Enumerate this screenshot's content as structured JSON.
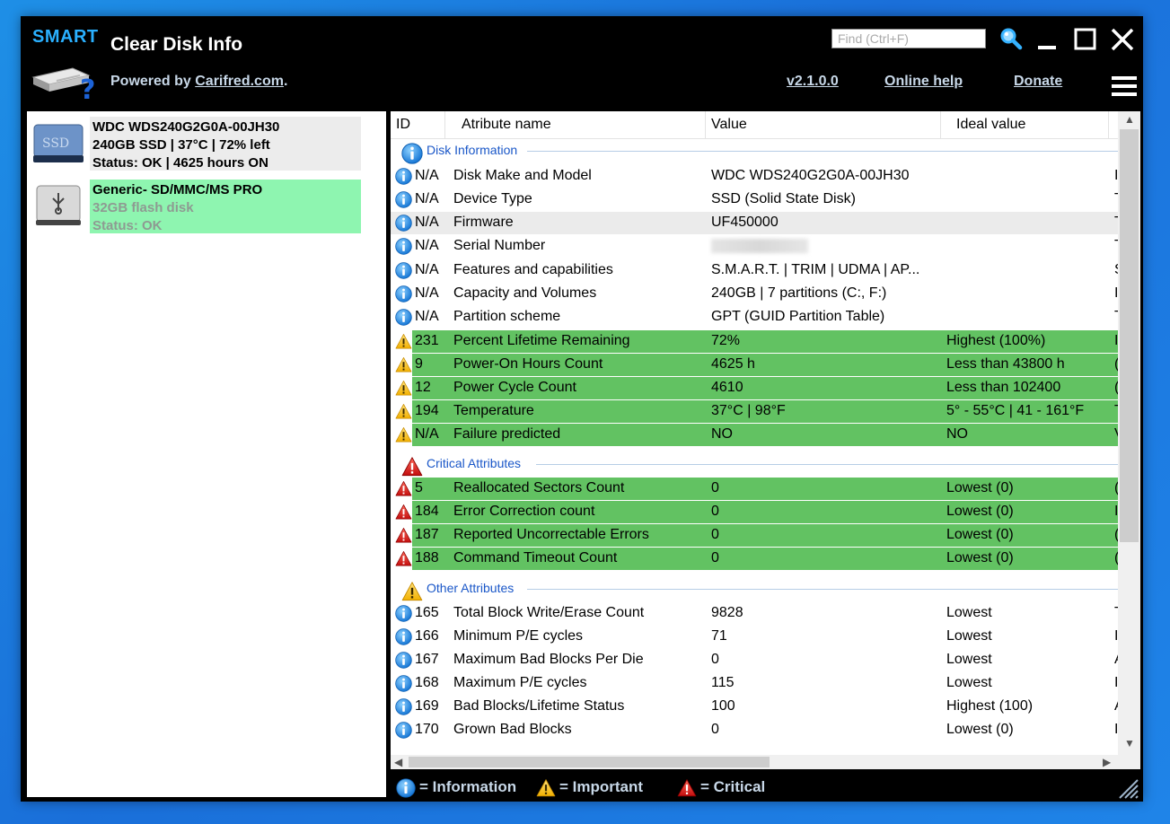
{
  "app": {
    "logo_text": "SMART",
    "title": "Clear Disk Info",
    "powered_prefix": "Powered by ",
    "powered_link": "Carifred.com",
    "powered_suffix": ".",
    "find_placeholder": "Find (Ctrl+F)",
    "version_link": "v2.1.0.0",
    "help_link": "Online help",
    "donate_link": "Donate"
  },
  "disks": [
    {
      "line1": "WDC WDS240G2G0A-00JH30",
      "line2": "240GB SSD | 37°C | 72% left",
      "line3": "Status: OK | 4625 hours ON",
      "icon": "ssd-drive-icon",
      "selected": true
    },
    {
      "line1": "Generic- SD/MMC/MS PRO",
      "line2": "32GB flash disk",
      "line3": "Status: OK",
      "icon": "usb-drive-icon",
      "selected": false
    }
  ],
  "columns": [
    "ID",
    "Atribute name",
    "Value",
    "Ideal value"
  ],
  "groups": {
    "disk_info": "Disk Information",
    "critical": "Critical Attributes",
    "other": "Other Attributes"
  },
  "rows": [
    {
      "icon": "info-icon",
      "id": "N/A",
      "name": "Disk Make and Model",
      "value": "WDC WDS240G2G0A-00JH30",
      "ideal": "",
      "more": "I"
    },
    {
      "icon": "info-icon",
      "id": "N/A",
      "name": "Device Type",
      "value": "SSD (Solid State Disk)",
      "ideal": "",
      "more": "T"
    },
    {
      "icon": "info-icon",
      "id": "N/A",
      "name": "Firmware",
      "value": "UF450000",
      "ideal": "",
      "more": "T"
    },
    {
      "icon": "info-icon",
      "id": "N/A",
      "name": "Serial Number",
      "value": "",
      "ideal": "",
      "more": "T"
    },
    {
      "icon": "info-icon",
      "id": "N/A",
      "name": "Features and capabilities",
      "value": "S.M.A.R.T. | TRIM | UDMA | AP...",
      "ideal": "",
      "more": "S"
    },
    {
      "icon": "info-icon",
      "id": "N/A",
      "name": "Capacity and Volumes",
      "value": "240GB | 7 partitions (C:, F:)",
      "ideal": "",
      "more": "I"
    },
    {
      "icon": "info-icon",
      "id": "N/A",
      "name": "Partition scheme",
      "value": "GPT (GUID Partition Table)",
      "ideal": "",
      "more": "T"
    },
    {
      "icon": "warning-icon",
      "id": "231",
      "name": "Percent Lifetime Remaining",
      "value": "72%",
      "ideal": "Highest (100%)",
      "more": "I"
    },
    {
      "icon": "warning-icon",
      "id": "9",
      "name": "Power-On Hours Count",
      "value": "4625 h",
      "ideal": "Less than 43800 h",
      "more": "("
    },
    {
      "icon": "warning-icon",
      "id": "12",
      "name": "Power Cycle Count",
      "value": "4610",
      "ideal": "Less than 102400",
      "more": "("
    },
    {
      "icon": "warning-icon",
      "id": "194",
      "name": "Temperature",
      "value": "37°C | 98°F",
      "ideal": "5° - 55°C | 41 - 161°F",
      "more": "T"
    },
    {
      "icon": "warning-icon",
      "id": "N/A",
      "name": "Failure predicted",
      "value": "NO",
      "ideal": "NO",
      "more": "V"
    },
    {
      "icon": "critical-icon",
      "id": "5",
      "name": "Reallocated Sectors Count",
      "value": "0",
      "ideal": "Lowest (0)",
      "more": "("
    },
    {
      "icon": "critical-icon",
      "id": "184",
      "name": "Error Correction count",
      "value": "0",
      "ideal": "Lowest (0)",
      "more": "I"
    },
    {
      "icon": "critical-icon",
      "id": "187",
      "name": "Reported Uncorrectable Errors",
      "value": "0",
      "ideal": "Lowest (0)",
      "more": "("
    },
    {
      "icon": "critical-icon",
      "id": "188",
      "name": "Command Timeout Count",
      "value": "0",
      "ideal": "Lowest (0)",
      "more": "("
    },
    {
      "icon": "info-icon",
      "id": "165",
      "name": "Total Block Write/Erase Count",
      "value": "9828",
      "ideal": "Lowest",
      "more": "T"
    },
    {
      "icon": "info-icon",
      "id": "166",
      "name": "Minimum P/E cycles",
      "value": "71",
      "ideal": "Lowest",
      "more": "I"
    },
    {
      "icon": "info-icon",
      "id": "167",
      "name": "Maximum Bad Blocks Per Die",
      "value": "0",
      "ideal": "Lowest",
      "more": "A"
    },
    {
      "icon": "info-icon",
      "id": "168",
      "name": "Maximum P/E cycles",
      "value": "115",
      "ideal": "Lowest",
      "more": "I"
    },
    {
      "icon": "info-icon",
      "id": "169",
      "name": "Bad Blocks/Lifetime Status",
      "value": "100",
      "ideal": "Highest (100)",
      "more": "A"
    },
    {
      "icon": "info-icon",
      "id": "170",
      "name": "Grown Bad Blocks",
      "value": "0",
      "ideal": "Lowest (0)",
      "more": "I"
    }
  ],
  "legend": {
    "info": "= Information",
    "important": "= Important",
    "critical": "= Critical"
  },
  "colors": {
    "window_bg": "#000000",
    "accent_blue": "#2ab0ff",
    "row_green": "#62c262",
    "selected_disk": "#8ef5b0",
    "group_text": "#1a57c8"
  }
}
